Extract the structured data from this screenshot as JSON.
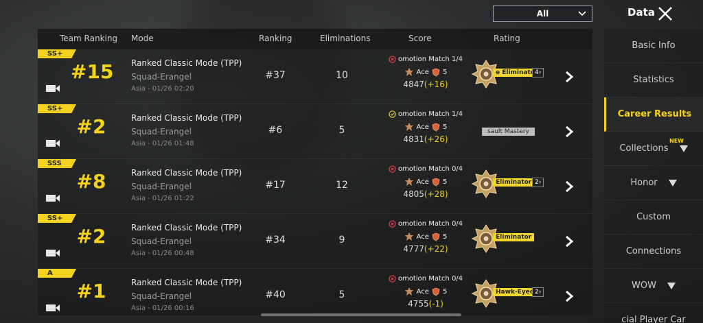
{
  "top": {
    "filter_value": "All",
    "title": "Data"
  },
  "columns": {
    "team_ranking": "Team Ranking",
    "mode": "Mode",
    "ranking": "Ranking",
    "eliminations": "Eliminations",
    "score": "Score",
    "rating": "Rating"
  },
  "rows": [
    {
      "tier": "SS+",
      "team_rank": "#15",
      "mode": "Ranked Classic Mode (TPP)",
      "map": "Squad-Erangel",
      "meta": "Asia - 01/26 02:20",
      "ranking": "#37",
      "eliminations": "10",
      "promo": "omotion Match 1/4",
      "promo_status": "fail",
      "tier_name": "Ace",
      "tier_level": "5",
      "points": "4847",
      "delta": "(+16)",
      "rating_label": "e Eliminator",
      "rating_count": "4"
    },
    {
      "tier": "SS+",
      "team_rank": "#2",
      "mode": "Ranked Classic Mode (TPP)",
      "map": "Squad-Erangel",
      "meta": "Asia - 01/26 01:48",
      "ranking": "#6",
      "eliminations": "5",
      "promo": "omotion Match 1/4",
      "promo_status": "pass",
      "tier_name": "Ace",
      "tier_level": "5",
      "points": "4831",
      "delta": "(+26)",
      "rating_label": "sault Mastery",
      "rating_count": ""
    },
    {
      "tier": "SSS",
      "team_rank": "#8",
      "mode": "Ranked Classic Mode (TPP)",
      "map": "Squad-Erangel",
      "meta": "Asia - 01/26 01:22",
      "ranking": "#17",
      "eliminations": "12",
      "promo": "omotion Match 0/4",
      "promo_status": "fail",
      "tier_name": "Ace",
      "tier_level": "5",
      "points": "4805",
      "delta": "(+28)",
      "rating_label": "Eliminator",
      "rating_count": "2"
    },
    {
      "tier": "SS+",
      "team_rank": "#2",
      "mode": "Ranked Classic Mode (TPP)",
      "map": "Squad-Erangel",
      "meta": "Asia - 01/26 00:48",
      "ranking": "#34",
      "eliminations": "9",
      "promo": "omotion Match 0/4",
      "promo_status": "fail",
      "tier_name": "Ace",
      "tier_level": "5",
      "points": "4777",
      "delta": "(+22)",
      "rating_label": "Eliminator",
      "rating_count": ""
    },
    {
      "tier": "A",
      "team_rank": "#1",
      "mode": "Ranked Classic Mode (TPP)",
      "map": "Squad-Erangel",
      "meta": "Asia - 01/26 00:16",
      "ranking": "#40",
      "eliminations": "5",
      "promo": "omotion Match 0/4",
      "promo_status": "fail",
      "tier_name": "Ace",
      "tier_level": "5",
      "points": "4755",
      "delta": "(-1)",
      "rating_label": "Hawk-Eyed",
      "rating_count": "2"
    }
  ],
  "sidebar": {
    "items": [
      {
        "label": "Basic Info"
      },
      {
        "label": "Statistics"
      },
      {
        "label": "Career Results"
      },
      {
        "label": "Collections",
        "badge": "NEW"
      },
      {
        "label": "Honor"
      },
      {
        "label": "Custom"
      },
      {
        "label": "Connections"
      },
      {
        "label": "WOW"
      },
      {
        "label": "cial Player Car"
      }
    ]
  },
  "colors": {
    "accent": "#f5d21a",
    "fail": "#e0404a",
    "pass": "#f5d21a"
  }
}
